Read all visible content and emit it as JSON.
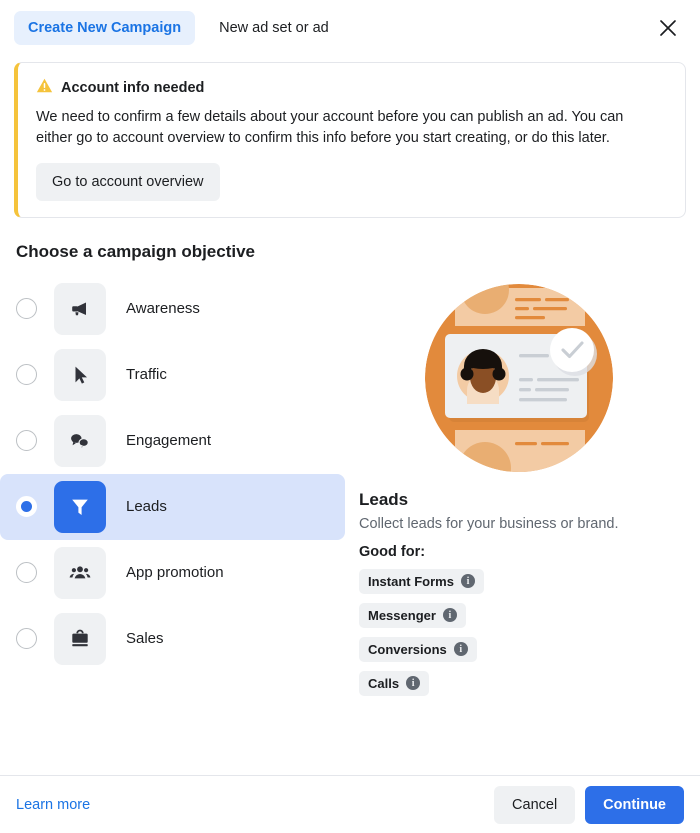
{
  "header": {
    "tab_active_label": "Create New Campaign",
    "tab_inactive_label": "New ad set or ad",
    "close_icon": "close-icon"
  },
  "alert": {
    "icon": "warning-triangle-icon",
    "title": "Account info needed",
    "body": "We need to confirm a few details about your account before you can publish an ad. You can either go to account overview to confirm this info before you start creating, or do this later.",
    "button_label": "Go to account overview",
    "accent_color": "#f5c33b"
  },
  "objectives": {
    "section_title": "Choose a campaign objective",
    "selected_index": 3,
    "accent_color": "#2d6fe8",
    "selected_row_color": "#d8e3fb",
    "items": [
      {
        "label": "Awareness",
        "icon": "megaphone-icon",
        "selected": false
      },
      {
        "label": "Traffic",
        "icon": "cursor-arrow-icon",
        "selected": false
      },
      {
        "label": "Engagement",
        "icon": "chat-bubbles-icon",
        "selected": false
      },
      {
        "label": "Leads",
        "icon": "funnel-icon",
        "selected": true
      },
      {
        "label": "App promotion",
        "icon": "people-group-icon",
        "selected": false
      },
      {
        "label": "Sales",
        "icon": "briefcase-icon",
        "selected": false
      }
    ]
  },
  "detail": {
    "illustration": "leads-profile-card-illustration",
    "title": "Leads",
    "description": "Collect leads for your business or brand.",
    "good_for_label": "Good for:",
    "tags": [
      {
        "label": "Instant Forms",
        "info_icon": "info-icon"
      },
      {
        "label": "Messenger",
        "info_icon": "info-icon"
      },
      {
        "label": "Conversions",
        "info_icon": "info-icon"
      },
      {
        "label": "Calls",
        "info_icon": "info-icon"
      }
    ]
  },
  "footer": {
    "learn_more_label": "Learn more",
    "cancel_label": "Cancel",
    "continue_label": "Continue"
  }
}
